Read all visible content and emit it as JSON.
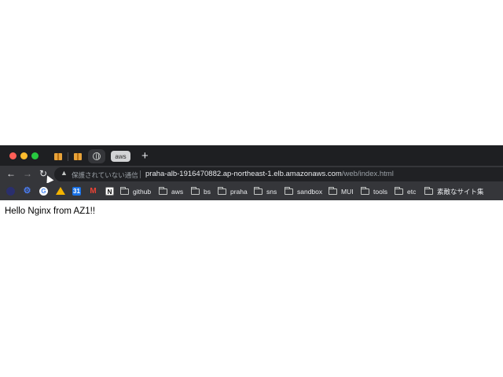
{
  "tabs": {
    "items": [
      {
        "icon": "aws-box-icon"
      },
      {
        "icon": "aws-box-icon"
      },
      {
        "icon": "globe-icon"
      },
      {
        "label": "aws"
      }
    ],
    "new_tab_symbol": "+"
  },
  "toolbar": {
    "back_symbol": "←",
    "forward_symbol": "→",
    "reload_symbol": "↻",
    "security_warning": "保護されていない通信",
    "url_host": "praha-alb-1916470882.ap-northeast-1.elb.amazonaws.com",
    "url_path": "/web/index.html"
  },
  "bookmarks": {
    "icons": [
      "app-icon",
      "gear-icon",
      "google-icon",
      "google-drive-icon",
      "calendar-icon",
      "gmail-icon",
      "notion-icon"
    ],
    "calendar_text": "31",
    "google_text": "G",
    "gmail_text": "M",
    "notion_text": "N",
    "folders": [
      "github",
      "aws",
      "bs",
      "praha",
      "sns",
      "sandbox",
      "MUI",
      "tools",
      "etc",
      "素敵なサイト集"
    ]
  },
  "page": {
    "body_text": "Hello Nginx from AZ1!!"
  },
  "colors": {
    "tab_strip": "#1e1f22",
    "toolbar": "#35363a",
    "omnibox": "#202124",
    "close": "#fe5f57",
    "minimize": "#febc2e",
    "maximize": "#28c840"
  }
}
